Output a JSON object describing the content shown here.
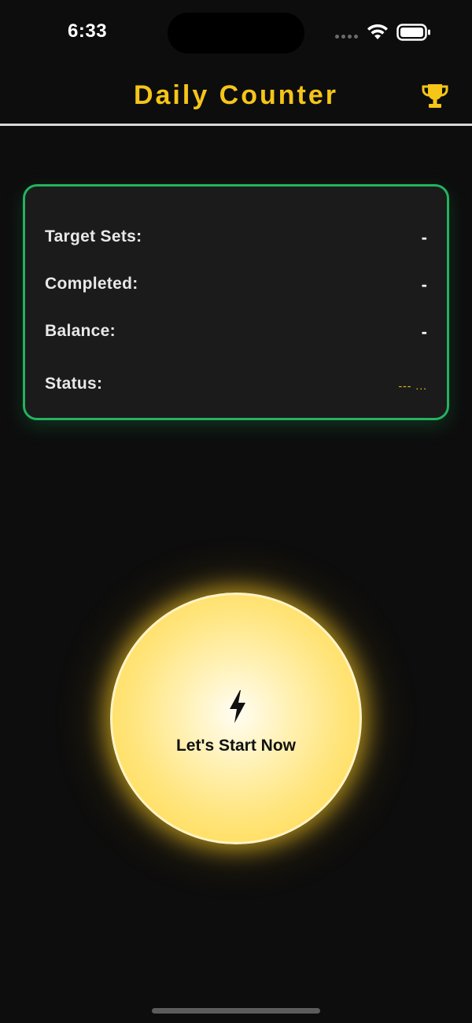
{
  "status_bar": {
    "time": "6:33"
  },
  "header": {
    "title": "Daily Counter",
    "trophy_icon": "trophy-icon"
  },
  "stats": {
    "target_sets": {
      "label": "Target Sets:",
      "value": "-"
    },
    "completed": {
      "label": "Completed:",
      "value": "-"
    },
    "balance": {
      "label": "Balance:",
      "value": "-"
    },
    "status": {
      "label": "Status:",
      "value": "--- ..."
    }
  },
  "start_button": {
    "label": "Let's Start Now",
    "icon": "bolt-icon"
  },
  "colors": {
    "background": "#0d0d0d",
    "accent_yellow": "#f5c518",
    "card_border_green": "#22b35e",
    "card_background": "#1b1b1b"
  }
}
